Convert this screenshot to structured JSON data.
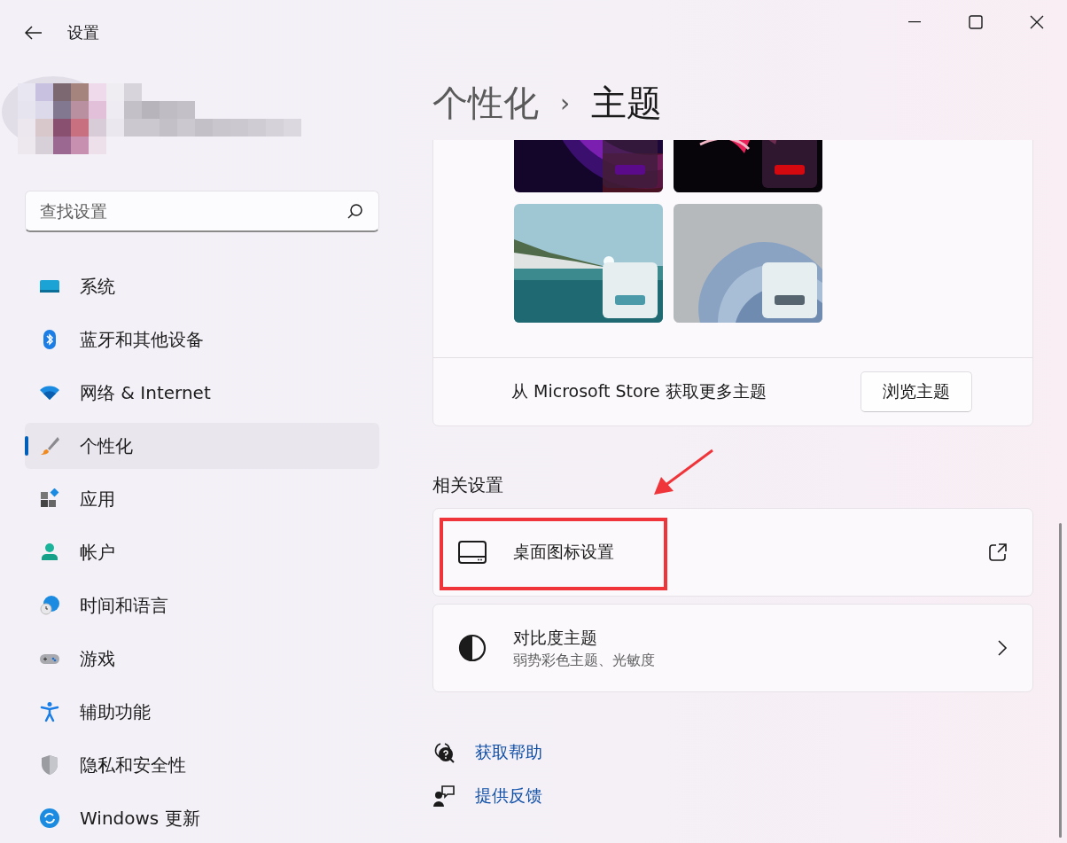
{
  "window": {
    "title": "设置"
  },
  "search": {
    "placeholder": "查找设置"
  },
  "nav": [
    {
      "kind": "system",
      "label": "系统",
      "selected": false
    },
    {
      "kind": "bluetooth",
      "label": "蓝牙和其他设备",
      "selected": false
    },
    {
      "kind": "network",
      "label": "网络 & Internet",
      "selected": false
    },
    {
      "kind": "personalize",
      "label": "个性化",
      "selected": true
    },
    {
      "kind": "apps",
      "label": "应用",
      "selected": false
    },
    {
      "kind": "account",
      "label": "帐户",
      "selected": false
    },
    {
      "kind": "time",
      "label": "时间和语言",
      "selected": false
    },
    {
      "kind": "gaming",
      "label": "游戏",
      "selected": false
    },
    {
      "kind": "accessibility",
      "label": "辅助功能",
      "selected": false
    },
    {
      "kind": "privacy",
      "label": "隐私和安全性",
      "selected": false
    },
    {
      "kind": "update",
      "label": "Windows 更新",
      "selected": false
    }
  ],
  "breadcrumb": {
    "parent": "个性化",
    "separator": "›",
    "current": "主题"
  },
  "themes": [
    {
      "kind": "bloom-dark",
      "color": "#5c0a8c"
    },
    {
      "kind": "ribbon-dark",
      "color": "#d4090f"
    },
    {
      "kind": "lake",
      "color": "#4a9aaa"
    },
    {
      "kind": "bloom-light",
      "color": "#56656f"
    }
  ],
  "store": {
    "text": "从 Microsoft Store 获取更多主题",
    "button": "浏览主题"
  },
  "related": {
    "heading": "相关设置",
    "items": [
      {
        "kind": "external",
        "title": "桌面图标设置",
        "highlighted": true
      },
      {
        "kind": "chevron",
        "title": "对比度主题",
        "subtitle": "弱势彩色主题、光敏度",
        "highlighted": false
      }
    ]
  },
  "links": [
    {
      "kind": "help",
      "label": "获取帮助"
    },
    {
      "kind": "feedback",
      "label": "提供反馈"
    }
  ]
}
